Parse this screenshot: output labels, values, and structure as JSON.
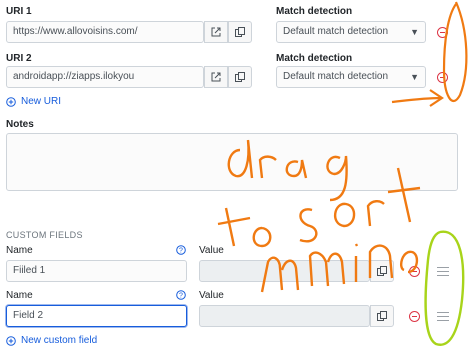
{
  "uris": [
    {
      "label": "URI 1",
      "value": "https://www.allovoisins.com/",
      "match_label": "Match detection",
      "match_value": "Default match detection"
    },
    {
      "label": "URI 2",
      "value": "androidapp://ziapps.ilokyou",
      "match_label": "Match detection",
      "match_value": "Default match detection"
    }
  ],
  "new_uri_label": "New URI",
  "notes_label": "Notes",
  "notes_value": "",
  "custom_fields_title": "CUSTOM FIELDS",
  "fields": [
    {
      "name_label": "Name",
      "value_label": "Value",
      "name_value": "Fiiled 1",
      "value_value": ""
    },
    {
      "name_label": "Name",
      "value_label": "Value",
      "name_value": "Field 2",
      "value_value": ""
    }
  ],
  "new_custom_field_label": "New custom field",
  "annotation_text": "drag to sort items",
  "colors": {
    "accent": "#175ddc",
    "danger": "#dc3545",
    "annotation_orange": "#f07a12",
    "annotation_green": "#a8d41a"
  },
  "icons": [
    "launch-icon",
    "copy-icon",
    "remove-icon",
    "help-icon",
    "add-icon",
    "drag-handle-icon"
  ]
}
